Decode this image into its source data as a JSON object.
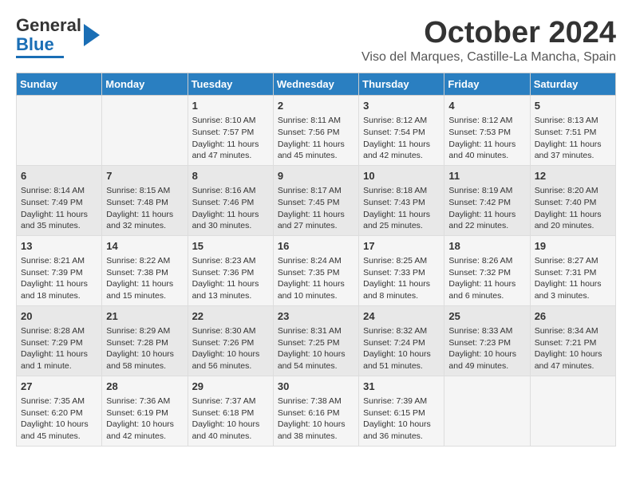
{
  "header": {
    "logo_line1": "General",
    "logo_line2": "Blue",
    "month": "October 2024",
    "location": "Viso del Marques, Castille-La Mancha, Spain"
  },
  "days_of_week": [
    "Sunday",
    "Monday",
    "Tuesday",
    "Wednesday",
    "Thursday",
    "Friday",
    "Saturday"
  ],
  "weeks": [
    [
      {
        "day": "",
        "info": ""
      },
      {
        "day": "",
        "info": ""
      },
      {
        "day": "1",
        "info": "Sunrise: 8:10 AM\nSunset: 7:57 PM\nDaylight: 11 hours and 47 minutes."
      },
      {
        "day": "2",
        "info": "Sunrise: 8:11 AM\nSunset: 7:56 PM\nDaylight: 11 hours and 45 minutes."
      },
      {
        "day": "3",
        "info": "Sunrise: 8:12 AM\nSunset: 7:54 PM\nDaylight: 11 hours and 42 minutes."
      },
      {
        "day": "4",
        "info": "Sunrise: 8:12 AM\nSunset: 7:53 PM\nDaylight: 11 hours and 40 minutes."
      },
      {
        "day": "5",
        "info": "Sunrise: 8:13 AM\nSunset: 7:51 PM\nDaylight: 11 hours and 37 minutes."
      }
    ],
    [
      {
        "day": "6",
        "info": "Sunrise: 8:14 AM\nSunset: 7:49 PM\nDaylight: 11 hours and 35 minutes."
      },
      {
        "day": "7",
        "info": "Sunrise: 8:15 AM\nSunset: 7:48 PM\nDaylight: 11 hours and 32 minutes."
      },
      {
        "day": "8",
        "info": "Sunrise: 8:16 AM\nSunset: 7:46 PM\nDaylight: 11 hours and 30 minutes."
      },
      {
        "day": "9",
        "info": "Sunrise: 8:17 AM\nSunset: 7:45 PM\nDaylight: 11 hours and 27 minutes."
      },
      {
        "day": "10",
        "info": "Sunrise: 8:18 AM\nSunset: 7:43 PM\nDaylight: 11 hours and 25 minutes."
      },
      {
        "day": "11",
        "info": "Sunrise: 8:19 AM\nSunset: 7:42 PM\nDaylight: 11 hours and 22 minutes."
      },
      {
        "day": "12",
        "info": "Sunrise: 8:20 AM\nSunset: 7:40 PM\nDaylight: 11 hours and 20 minutes."
      }
    ],
    [
      {
        "day": "13",
        "info": "Sunrise: 8:21 AM\nSunset: 7:39 PM\nDaylight: 11 hours and 18 minutes."
      },
      {
        "day": "14",
        "info": "Sunrise: 8:22 AM\nSunset: 7:38 PM\nDaylight: 11 hours and 15 minutes."
      },
      {
        "day": "15",
        "info": "Sunrise: 8:23 AM\nSunset: 7:36 PM\nDaylight: 11 hours and 13 minutes."
      },
      {
        "day": "16",
        "info": "Sunrise: 8:24 AM\nSunset: 7:35 PM\nDaylight: 11 hours and 10 minutes."
      },
      {
        "day": "17",
        "info": "Sunrise: 8:25 AM\nSunset: 7:33 PM\nDaylight: 11 hours and 8 minutes."
      },
      {
        "day": "18",
        "info": "Sunrise: 8:26 AM\nSunset: 7:32 PM\nDaylight: 11 hours and 6 minutes."
      },
      {
        "day": "19",
        "info": "Sunrise: 8:27 AM\nSunset: 7:31 PM\nDaylight: 11 hours and 3 minutes."
      }
    ],
    [
      {
        "day": "20",
        "info": "Sunrise: 8:28 AM\nSunset: 7:29 PM\nDaylight: 11 hours and 1 minute."
      },
      {
        "day": "21",
        "info": "Sunrise: 8:29 AM\nSunset: 7:28 PM\nDaylight: 10 hours and 58 minutes."
      },
      {
        "day": "22",
        "info": "Sunrise: 8:30 AM\nSunset: 7:26 PM\nDaylight: 10 hours and 56 minutes."
      },
      {
        "day": "23",
        "info": "Sunrise: 8:31 AM\nSunset: 7:25 PM\nDaylight: 10 hours and 54 minutes."
      },
      {
        "day": "24",
        "info": "Sunrise: 8:32 AM\nSunset: 7:24 PM\nDaylight: 10 hours and 51 minutes."
      },
      {
        "day": "25",
        "info": "Sunrise: 8:33 AM\nSunset: 7:23 PM\nDaylight: 10 hours and 49 minutes."
      },
      {
        "day": "26",
        "info": "Sunrise: 8:34 AM\nSunset: 7:21 PM\nDaylight: 10 hours and 47 minutes."
      }
    ],
    [
      {
        "day": "27",
        "info": "Sunrise: 7:35 AM\nSunset: 6:20 PM\nDaylight: 10 hours and 45 minutes."
      },
      {
        "day": "28",
        "info": "Sunrise: 7:36 AM\nSunset: 6:19 PM\nDaylight: 10 hours and 42 minutes."
      },
      {
        "day": "29",
        "info": "Sunrise: 7:37 AM\nSunset: 6:18 PM\nDaylight: 10 hours and 40 minutes."
      },
      {
        "day": "30",
        "info": "Sunrise: 7:38 AM\nSunset: 6:16 PM\nDaylight: 10 hours and 38 minutes."
      },
      {
        "day": "31",
        "info": "Sunrise: 7:39 AM\nSunset: 6:15 PM\nDaylight: 10 hours and 36 minutes."
      },
      {
        "day": "",
        "info": ""
      },
      {
        "day": "",
        "info": ""
      }
    ]
  ]
}
